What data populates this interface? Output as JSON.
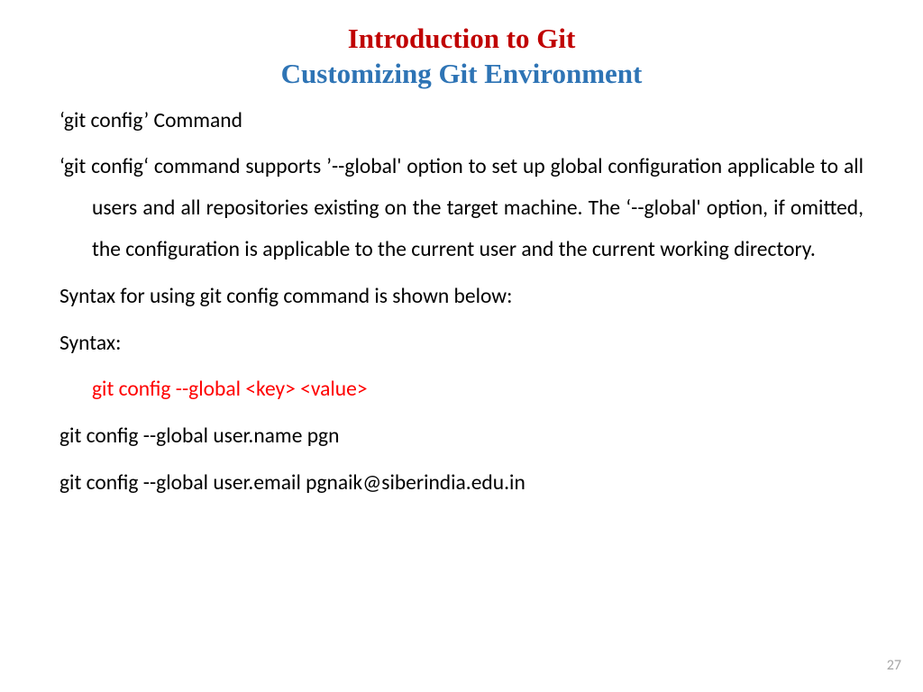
{
  "title": {
    "main": "Introduction to Git",
    "sub": "Customizing Git Environment"
  },
  "body": {
    "heading": "‘git config’ Command",
    "paragraph": "‘git config‘ command supports ’--global' option to set up global configuration applicable to all users and all repositories existing on the target machine. The ‘--global' option, if omitted, the configuration is applicable to the current user and the current working directory.",
    "syntax_intro": "Syntax for using git config command is shown below:",
    "syntax_label": "Syntax:",
    "syntax_code": "git config --global <key> <value>",
    "example1": "git config --global user.name pgn",
    "example2": "git config --global user.email pgnaik@siberindia.edu.in"
  },
  "page_number": "27"
}
